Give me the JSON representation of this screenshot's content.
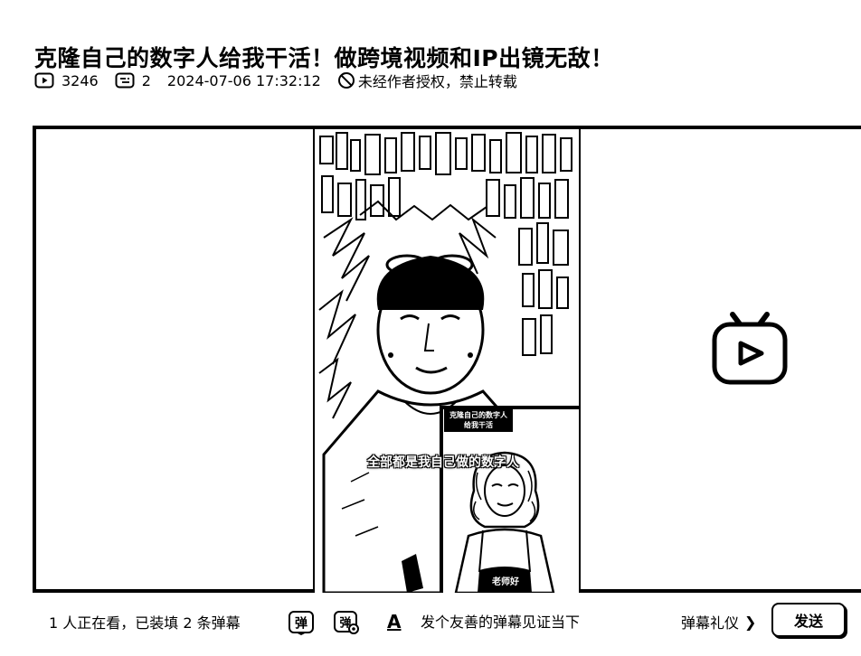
{
  "video": {
    "title": "克隆自己的数字人给我干活！做跨境视频和IP出镜无敌！",
    "play_count": "3246",
    "danmaku_count": "2",
    "publish_time": "2024-07-06 17:32:12",
    "copyright_notice": "未经作者授权，禁止转载"
  },
  "player": {
    "subtitle": "全部都是我自己做的数字人",
    "overlay_caption": "克隆自己的数字人给我干活",
    "greeting_caption": "老师好",
    "play_badge_icon": "tv-play-icon"
  },
  "danmaku_bar": {
    "viewers_text": "1 人正在看，已装填 2 条弹幕",
    "toggle_label": "弹",
    "settings_label": "弹",
    "input_style_icon": "A",
    "input_placeholder": "发个友善的弹幕见证当下",
    "etiquette_label": "弹幕礼仪",
    "send_label": "发送"
  }
}
